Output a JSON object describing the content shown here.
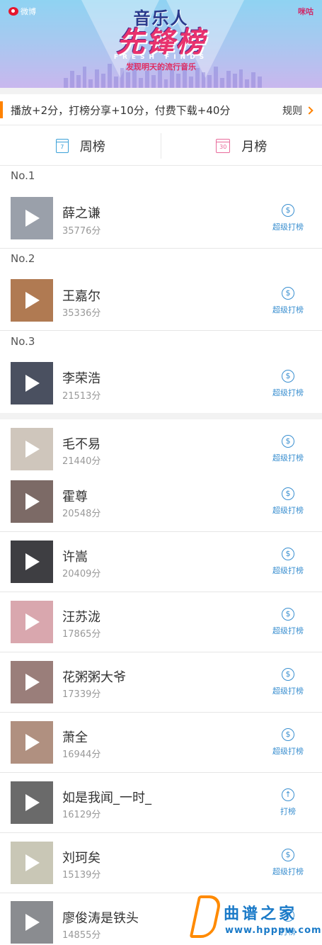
{
  "banner": {
    "brand_left": "微博",
    "brand_right": "咪咕",
    "title_top": "音乐人",
    "title_main": "先锋榜",
    "subtitle_en": "FRESH FINDS",
    "slogan": "发现明天的流行音乐"
  },
  "notice": {
    "text": "播放+2分，打榜分享+10分，付费下载+40分",
    "rules_label": "规则"
  },
  "tabs": [
    {
      "label": "周榜",
      "icon": "calendar-week-icon",
      "icon_text": "7"
    },
    {
      "label": "月榜",
      "icon": "calendar-month-icon",
      "icon_text": "30"
    }
  ],
  "top3": [
    {
      "rank": "No.1",
      "name": "薛之谦",
      "score": "35776分",
      "action": "超级打榜",
      "action_icon": "dollar-circle-icon",
      "color": "#9aa0aa"
    },
    {
      "rank": "No.2",
      "name": "王嘉尔",
      "score": "35336分",
      "action": "超级打榜",
      "action_icon": "dollar-circle-icon",
      "color": "#b07a52"
    },
    {
      "rank": "No.3",
      "name": "李荣浩",
      "score": "21513分",
      "action": "超级打榜",
      "action_icon": "dollar-circle-icon",
      "color": "#4a5060"
    }
  ],
  "others": [
    {
      "name": "毛不易",
      "score": "21440分",
      "action": "超级打榜",
      "action_icon": "dollar-circle-icon",
      "color": "#cfc6bc"
    },
    {
      "name": "霍尊",
      "score": "20548分",
      "action": "超级打榜",
      "action_icon": "dollar-circle-icon",
      "color": "#7c6a66"
    },
    {
      "name": "许嵩",
      "score": "20409分",
      "action": "超级打榜",
      "action_icon": "dollar-circle-icon",
      "color": "#3e3e42"
    },
    {
      "name": "汪苏泷",
      "score": "17865分",
      "action": "超级打榜",
      "action_icon": "dollar-circle-icon",
      "color": "#d9a7ae"
    },
    {
      "name": "花粥粥大爷",
      "score": "17339分",
      "action": "超级打榜",
      "action_icon": "dollar-circle-icon",
      "color": "#9a7e7a"
    },
    {
      "name": "萧全",
      "score": "16944分",
      "action": "超级打榜",
      "action_icon": "dollar-circle-icon",
      "color": "#b09080"
    },
    {
      "name": "如是我闻_一时_",
      "score": "16129分",
      "action": "打榜",
      "action_icon": "arrow-up-circle-icon",
      "color": "#6a6a6a"
    },
    {
      "name": "刘珂矣",
      "score": "15139分",
      "action": "超级打榜",
      "action_icon": "dollar-circle-icon",
      "color": "#c9c7b6"
    },
    {
      "name": "廖俊涛是铁头",
      "score": "14855分",
      "action": "打榜",
      "action_icon": "arrow-up-circle-icon",
      "color": "#8a8c90"
    }
  ],
  "watermark": {
    "site": "曲谱之家",
    "url": "www.hpppw.com"
  },
  "colors": {
    "accent_orange": "#ff8200",
    "action_blue": "#3a8fd0"
  }
}
